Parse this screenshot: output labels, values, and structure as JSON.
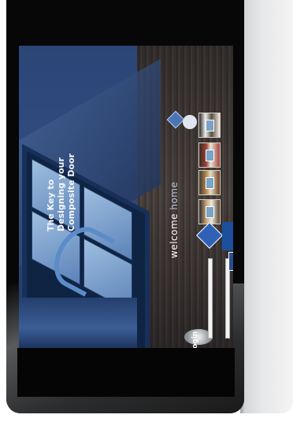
{
  "screen": {
    "headline_lines": [
      "The Key to",
      "Designing your",
      "Composite Door"
    ],
    "welcome": {
      "prefix": "welcome ",
      "suffix": "home"
    },
    "login": {
      "title": "login"
    }
  },
  "colors": {
    "screen_blue": "#2c4577",
    "wood": "#5a4a3c",
    "bezel": "#070707",
    "panel_grey": "#e6e7e8"
  }
}
